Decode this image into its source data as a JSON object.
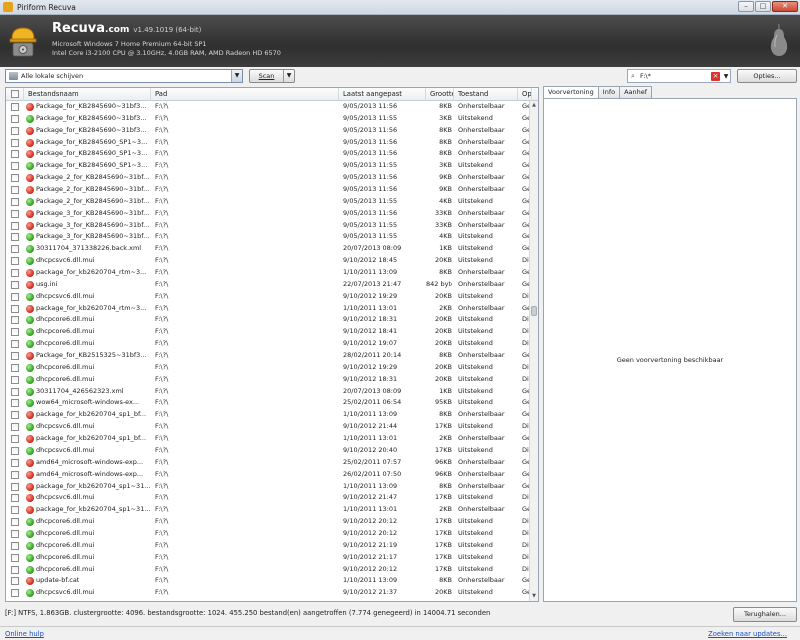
{
  "window": {
    "title": "Piriform Recuva"
  },
  "header": {
    "app_name": "Recuva",
    "app_suffix": ".com",
    "version": "v1.49.1019 (64-bit)",
    "os_line": "Microsoft Windows 7 Home Premium 64-bit SP1",
    "hw_line": "Intel Core i3-2100 CPU @ 3.10GHz, 4.0GB RAM, AMD Radeon HD 6570"
  },
  "toolbar": {
    "drive_value": "Alle lokale schijven",
    "scan_label": "Scan",
    "search_value": "F:\\*",
    "options_label": "Opties..."
  },
  "columns": {
    "name": "Bestandsnaam",
    "path": "Pad",
    "modified": "Laatst aangepast",
    "size": "Grootte",
    "state": "Toestand",
    "more": "Op"
  },
  "rows": [
    {
      "name": "Package_for_KB2845690~31bf3...",
      "path": "F:\\?\\",
      "date": "9/05/2013 11:56",
      "size": "8KB",
      "state": "Onherstelbaar",
      "op": "Ge",
      "status": "red"
    },
    {
      "name": "Package_for_KB2845690~31bf3...",
      "path": "F:\\?\\",
      "date": "9/05/2013 11:55",
      "size": "3KB",
      "state": "Uitstekend",
      "op": "Ge",
      "status": "green"
    },
    {
      "name": "Package_for_KB2845690~31bf3...",
      "path": "F:\\?\\",
      "date": "9/05/2013 11:56",
      "size": "8KB",
      "state": "Onherstelbaar",
      "op": "Ge",
      "status": "red"
    },
    {
      "name": "Package_for_KB2845690_SP1~3...",
      "path": "F:\\?\\",
      "date": "9/05/2013 11:56",
      "size": "8KB",
      "state": "Onherstelbaar",
      "op": "Ge",
      "status": "red"
    },
    {
      "name": "Package_for_KB2845690_SP1~3...",
      "path": "F:\\?\\",
      "date": "9/05/2013 11:56",
      "size": "8KB",
      "state": "Onherstelbaar",
      "op": "Ge",
      "status": "red"
    },
    {
      "name": "Package_for_KB2845690_SP1~3...",
      "path": "F:\\?\\",
      "date": "9/05/2013 11:55",
      "size": "3KB",
      "state": "Uitstekend",
      "op": "Ge",
      "status": "green"
    },
    {
      "name": "Package_2_for_KB2845690~31bf...",
      "path": "F:\\?\\",
      "date": "9/05/2013 11:56",
      "size": "9KB",
      "state": "Onherstelbaar",
      "op": "Ge",
      "status": "red"
    },
    {
      "name": "Package_2_for_KB2845690~31bf...",
      "path": "F:\\?\\",
      "date": "9/05/2013 11:56",
      "size": "9KB",
      "state": "Onherstelbaar",
      "op": "Ge",
      "status": "red"
    },
    {
      "name": "Package_2_for_KB2845690~31bf...",
      "path": "F:\\?\\",
      "date": "9/05/2013 11:55",
      "size": "4KB",
      "state": "Uitstekend",
      "op": "Ge",
      "status": "green"
    },
    {
      "name": "Package_3_for_KB2845690~31bf...",
      "path": "F:\\?\\",
      "date": "9/05/2013 11:56",
      "size": "33KB",
      "state": "Onherstelbaar",
      "op": "Ge",
      "status": "red"
    },
    {
      "name": "Package_3_for_KB2845690~31bf...",
      "path": "F:\\?\\",
      "date": "9/05/2013 11:55",
      "size": "33KB",
      "state": "Onherstelbaar",
      "op": "Ge",
      "status": "red"
    },
    {
      "name": "Package_3_for_KB2845690~31bf...",
      "path": "F:\\?\\",
      "date": "9/05/2013 11:55",
      "size": "4KB",
      "state": "Uitstekend",
      "op": "Ge",
      "status": "green"
    },
    {
      "name": "30311704_371338226.back.xml",
      "path": "F:\\?\\",
      "date": "20/07/2013 08:09",
      "size": "1KB",
      "state": "Uitstekend",
      "op": "Ge",
      "status": "green"
    },
    {
      "name": "dhcpcsvc6.dll.mui",
      "path": "F:\\?\\",
      "date": "9/10/2012 18:45",
      "size": "20KB",
      "state": "Uitstekend",
      "op": "Dit",
      "status": "green"
    },
    {
      "name": "package_for_kb2620704_rtm~3...",
      "path": "F:\\?\\",
      "date": "1/10/2011 13:09",
      "size": "8KB",
      "state": "Onherstelbaar",
      "op": "Ge",
      "status": "red"
    },
    {
      "name": "usg.ini",
      "path": "F:\\?\\",
      "date": "22/07/2013 21:47",
      "size": "842 bytes",
      "state": "Onherstelbaar",
      "op": "Ge",
      "status": "red"
    },
    {
      "name": "dhcpcsvc6.dll.mui",
      "path": "F:\\?\\",
      "date": "9/10/2012 19:29",
      "size": "20KB",
      "state": "Uitstekend",
      "op": "Dit",
      "status": "green"
    },
    {
      "name": "package_for_kb2620704_rtm~3...",
      "path": "F:\\?\\",
      "date": "1/10/2011 13:01",
      "size": "2KB",
      "state": "Onherstelbaar",
      "op": "Ge",
      "status": "red"
    },
    {
      "name": "dhcpcore6.dll.mui",
      "path": "F:\\?\\",
      "date": "9/10/2012 18:31",
      "size": "20KB",
      "state": "Uitstekend",
      "op": "Dit",
      "status": "green"
    },
    {
      "name": "dhcpcore6.dll.mui",
      "path": "F:\\?\\",
      "date": "9/10/2012 18:41",
      "size": "20KB",
      "state": "Uitstekend",
      "op": "Dit",
      "status": "green"
    },
    {
      "name": "dhcpcore6.dll.mui",
      "path": "F:\\?\\",
      "date": "9/10/2012 19:07",
      "size": "20KB",
      "state": "Uitstekend",
      "op": "Dit",
      "status": "green"
    },
    {
      "name": "Package_for_KB2515325~31bf3...",
      "path": "F:\\?\\",
      "date": "28/02/2011 20:14",
      "size": "8KB",
      "state": "Onherstelbaar",
      "op": "Ge",
      "status": "red"
    },
    {
      "name": "dhcpcore6.dll.mui",
      "path": "F:\\?\\",
      "date": "9/10/2012 19:29",
      "size": "20KB",
      "state": "Uitstekend",
      "op": "Dit",
      "status": "green"
    },
    {
      "name": "dhcpcore6.dll.mui",
      "path": "F:\\?\\",
      "date": "9/10/2012 18:31",
      "size": "20KB",
      "state": "Uitstekend",
      "op": "Dit",
      "status": "green"
    },
    {
      "name": "30311704_426562323.xml",
      "path": "F:\\?\\",
      "date": "20/07/2013 08:09",
      "size": "1KB",
      "state": "Uitstekend",
      "op": "Ge",
      "status": "green"
    },
    {
      "name": "wow64_microsoft-windows-ex...",
      "path": "F:\\?\\",
      "date": "25/02/2011 06:54",
      "size": "95KB",
      "state": "Uitstekend",
      "op": "Ge",
      "status": "green"
    },
    {
      "name": "package_for_kb2620704_sp1_bf...",
      "path": "F:\\?\\",
      "date": "1/10/2011 13:09",
      "size": "8KB",
      "state": "Onherstelbaar",
      "op": "Ge",
      "status": "red"
    },
    {
      "name": "dhcpcsvc6.dll.mui",
      "path": "F:\\?\\",
      "date": "9/10/2012 21:44",
      "size": "17KB",
      "state": "Uitstekend",
      "op": "Dit",
      "status": "green"
    },
    {
      "name": "package_for_kb2620704_sp1_bf...",
      "path": "F:\\?\\",
      "date": "1/10/2011 13:01",
      "size": "2KB",
      "state": "Onherstelbaar",
      "op": "Ge",
      "status": "red"
    },
    {
      "name": "dhcpcsvc6.dll.mui",
      "path": "F:\\?\\",
      "date": "9/10/2012 20:40",
      "size": "17KB",
      "state": "Uitstekend",
      "op": "Dit",
      "status": "green"
    },
    {
      "name": "amd64_microsoft-windows-exp...",
      "path": "F:\\?\\",
      "date": "25/02/2011 07:57",
      "size": "96KB",
      "state": "Onherstelbaar",
      "op": "Ge",
      "status": "red"
    },
    {
      "name": "amd64_microsoft-windows-exp...",
      "path": "F:\\?\\",
      "date": "26/02/2011 07:50",
      "size": "96KB",
      "state": "Onherstelbaar",
      "op": "Ge",
      "status": "red"
    },
    {
      "name": "package_for_kb2620704_sp1~31...",
      "path": "F:\\?\\",
      "date": "1/10/2011 13:09",
      "size": "8KB",
      "state": "Onherstelbaar",
      "op": "Ge",
      "status": "red"
    },
    {
      "name": "dhcpcsvc6.dll.mui",
      "path": "F:\\?\\",
      "date": "9/10/2012 21:47",
      "size": "17KB",
      "state": "Uitstekend",
      "op": "Dit",
      "status": "red"
    },
    {
      "name": "package_for_kb2620704_sp1~31...",
      "path": "F:\\?\\",
      "date": "1/10/2011 13:01",
      "size": "2KB",
      "state": "Onherstelbaar",
      "op": "Ge",
      "status": "red"
    },
    {
      "name": "dhcpcore6.dll.mui",
      "path": "F:\\?\\",
      "date": "9/10/2012 20:12",
      "size": "17KB",
      "state": "Uitstekend",
      "op": "Dit",
      "status": "green"
    },
    {
      "name": "dhcpcore6.dll.mui",
      "path": "F:\\?\\",
      "date": "9/10/2012 20:12",
      "size": "17KB",
      "state": "Uitstekend",
      "op": "Dit",
      "status": "green"
    },
    {
      "name": "dhcpcore6.dll.mui",
      "path": "F:\\?\\",
      "date": "9/10/2012 21:19",
      "size": "17KB",
      "state": "Uitstekend",
      "op": "Dit",
      "status": "green"
    },
    {
      "name": "dhcpcore6.dll.mui",
      "path": "F:\\?\\",
      "date": "9/10/2012 21:17",
      "size": "17KB",
      "state": "Uitstekend",
      "op": "Dit",
      "status": "green"
    },
    {
      "name": "dhcpcore6.dll.mui",
      "path": "F:\\?\\",
      "date": "9/10/2012 20:12",
      "size": "17KB",
      "state": "Uitstekend",
      "op": "Dit",
      "status": "green"
    },
    {
      "name": "update-bf.cat",
      "path": "F:\\?\\",
      "date": "1/10/2011 13:09",
      "size": "8KB",
      "state": "Onherstelbaar",
      "op": "Ge",
      "status": "red"
    },
    {
      "name": "dhcpcsvc6.dll.mui",
      "path": "F:\\?\\",
      "date": "9/10/2012 21:37",
      "size": "20KB",
      "state": "Uitstekend",
      "op": "Ge",
      "status": "green"
    }
  ],
  "preview": {
    "tabs": [
      "Voorvertoning",
      "Info",
      "Aanhef"
    ],
    "empty_message": "Geen voorvertoning beschikbaar"
  },
  "status": {
    "text": "[F:] NTFS, 1.863GB. clustergrootte: 4096. bestandsgrootte: 1024. 455.250 bestand(en) aangetroffen (7.774 genegeerd) in 14004.71 seconden",
    "recover_label": "Terughalen..."
  },
  "footer": {
    "help_link": "Online hulp",
    "updates_link": "Zoeken naar updates..."
  },
  "colors": {
    "header_bg": "#3a3a3a",
    "status_green": "#2f9a1f",
    "status_red": "#c8281a",
    "link": "#1d4fbf"
  }
}
